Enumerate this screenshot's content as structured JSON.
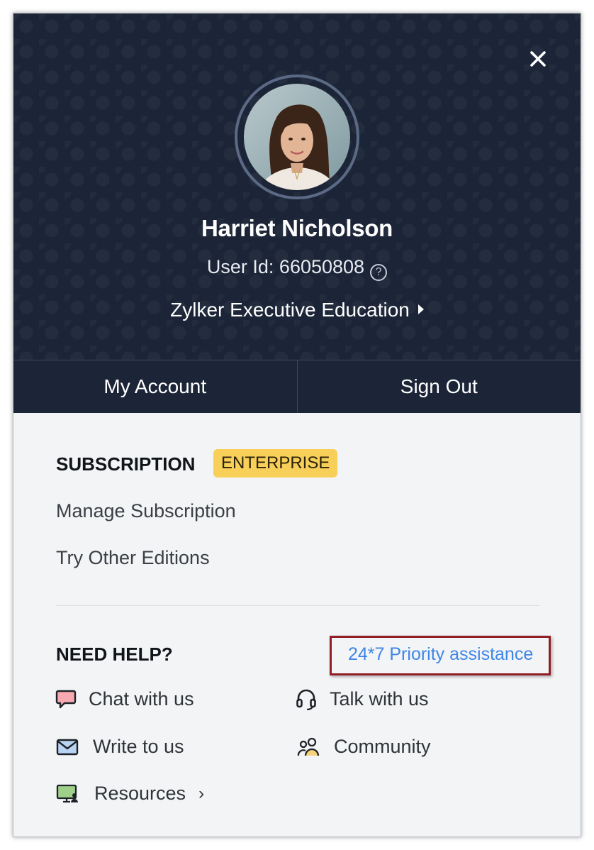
{
  "profile": {
    "name": "Harriet Nicholson",
    "user_id_label": "User Id: 66050808",
    "help_glyph": "?",
    "organization": "Zylker Executive Education"
  },
  "actions": {
    "my_account": "My Account",
    "sign_out": "Sign Out"
  },
  "subscription": {
    "title": "SUBSCRIPTION",
    "edition_badge": "ENTERPRISE",
    "manage": "Manage Subscription",
    "try_other": "Try Other Editions"
  },
  "help": {
    "title": "NEED HELP?",
    "priority": "24*7 Priority assistance",
    "chat": "Chat with us",
    "talk": "Talk with us",
    "write": "Write to us",
    "community": "Community",
    "resources": "Resources",
    "resources_chevron": "›"
  },
  "colors": {
    "header_bg": "#1c2537",
    "badge_bg": "#f8cf59",
    "link": "#3f86e6",
    "highlight_border": "#8f1f24"
  }
}
